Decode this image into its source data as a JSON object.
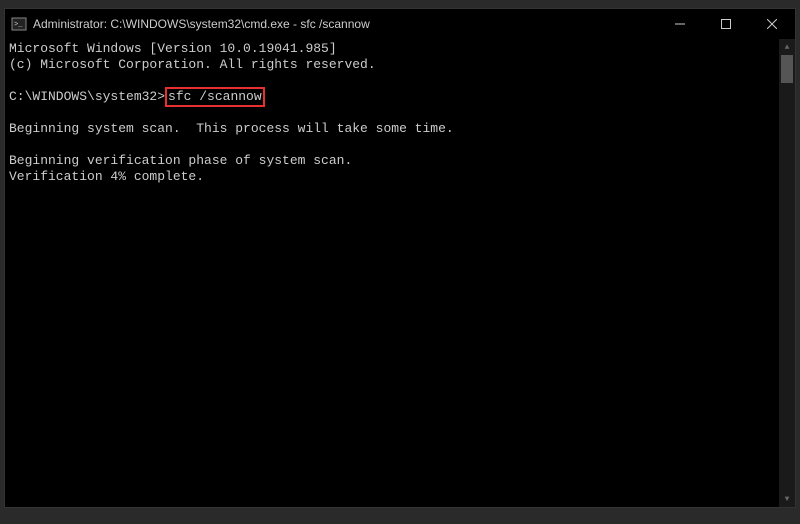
{
  "titlebar": {
    "title": "Administrator: C:\\WINDOWS\\system32\\cmd.exe - sfc  /scannow"
  },
  "terminal": {
    "line1": "Microsoft Windows [Version 10.0.19041.985]",
    "line2": "(c) Microsoft Corporation. All rights reserved.",
    "prompt": "C:\\WINDOWS\\system32>",
    "command": "sfc /scannow",
    "line5": "Beginning system scan.  This process will take some time.",
    "line7": "Beginning verification phase of system scan.",
    "line8": "Verification 4% complete."
  }
}
